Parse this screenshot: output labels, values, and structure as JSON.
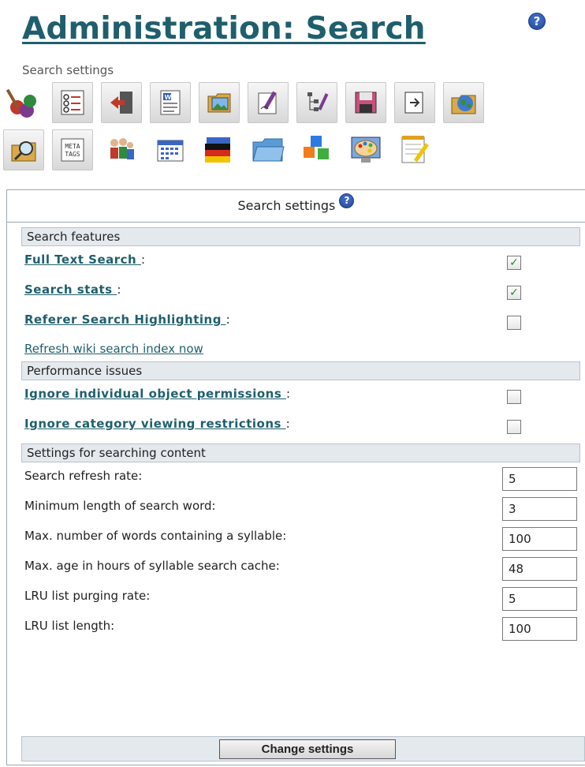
{
  "page": {
    "title": "Administration: Search",
    "subtitle": "Search settings"
  },
  "toolbar": {
    "row1": [
      "features-icon",
      "list-icon",
      "login-icon",
      "word-doc-icon",
      "image-gallery-icon",
      "edit-icon",
      "tree-icon",
      "save-icon",
      "export-icon",
      "globe-icon"
    ],
    "row2": [
      "search-folder-icon",
      "meta-tags-icon",
      "users-icon",
      "calendar-icon",
      "flag-icon",
      "folder-icon",
      "blocks-icon",
      "palette-icon",
      "notepad-icon"
    ],
    "meta_text": "META TAGS"
  },
  "panel": {
    "header": "Search settings",
    "sections": {
      "features": "Search features",
      "performance": "Performance issues",
      "content": "Settings for searching content"
    },
    "features": [
      {
        "label": "Full Text Search ",
        "checked": true
      },
      {
        "label": "Search stats ",
        "checked": true
      },
      {
        "label": "Referer Search Highlighting ",
        "checked": false
      }
    ],
    "refresh_link": "Refresh wiki search index now",
    "performance": [
      {
        "label": "Ignore individual object permissions ",
        "checked": false
      },
      {
        "label": "Ignore category viewing restrictions ",
        "checked": false
      }
    ],
    "content": [
      {
        "label": "Search refresh rate:",
        "value": "5"
      },
      {
        "label": "Minimum length of search word:",
        "value": "3"
      },
      {
        "label": "Max. number of words containing a syllable:",
        "value": "100"
      },
      {
        "label": "Max. age in hours of syllable search cache:",
        "value": "48"
      },
      {
        "label": "LRU list purging rate:",
        "value": "5"
      },
      {
        "label": "LRU list length:",
        "value": "100"
      }
    ],
    "colon": ":",
    "submit_label": "Change settings"
  },
  "help_glyph": "?",
  "check_glyph": "✓"
}
